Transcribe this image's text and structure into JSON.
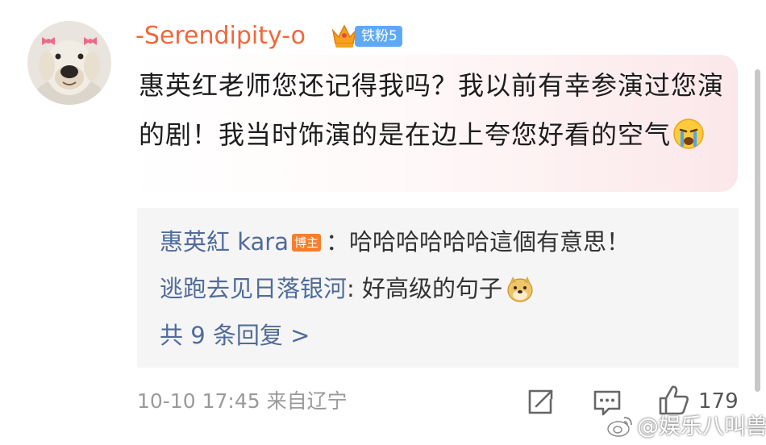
{
  "comment": {
    "username": "-Serendipity-o",
    "fan_badge": "铁粉5",
    "text": "惠英红老师您还记得我吗？我以前有幸参演过您演的剧！我当时饰演的是在边上夸您好看的空气"
  },
  "replies": [
    {
      "name": "惠英紅 kara",
      "badge": "博主",
      "separator": "：",
      "text": "哈哈哈哈哈哈這個有意思！"
    },
    {
      "name": "逃跑去见日落银河",
      "separator": ": ",
      "text": "好高级的句子"
    }
  ],
  "more_replies": "共 9 条回复 >",
  "footer": {
    "meta": "10-10 17:45  来自辽宁",
    "like_count": "179"
  },
  "watermark": "@娱乐八叫兽",
  "icons": [
    "avatar-dog",
    "crown-icon",
    "crying-emoji",
    "doge-emoji",
    "share-icon",
    "comment-icon",
    "like-icon",
    "weibo-logo"
  ],
  "colors": {
    "username": "#f1673a",
    "fan_badge": "#5ea9f6",
    "reply_name": "#506b9b",
    "blogger_badge": "#f77e2a"
  }
}
